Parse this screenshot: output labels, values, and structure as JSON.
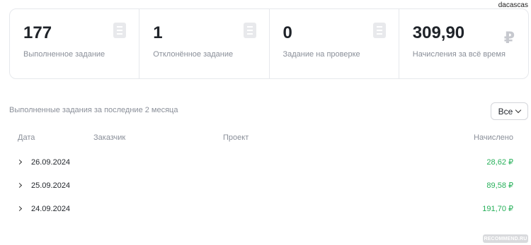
{
  "header": {
    "username": "dacascas"
  },
  "stats": [
    {
      "value": "177",
      "label": "Выполненное задание",
      "icon": "document-icon"
    },
    {
      "value": "1",
      "label": "Отклонённое задание",
      "icon": "document-icon"
    },
    {
      "value": "0",
      "label": "Задание на проверке",
      "icon": "document-icon"
    },
    {
      "value": "309,90",
      "label": "Начисления за всё время",
      "icon": "ruble-icon",
      "icon_glyph": "₽"
    }
  ],
  "history": {
    "title": "Выполненные задания за последние 2 месяца",
    "filter": {
      "selected": "Все"
    },
    "columns": {
      "date": "Дата",
      "client": "Заказчик",
      "project": "Проект",
      "amount": "Начислено"
    },
    "rows": [
      {
        "date": "26.09.2024",
        "client": "",
        "project": "",
        "amount": "28,62 ₽"
      },
      {
        "date": "25.09.2024",
        "client": "",
        "project": "",
        "amount": "89,58 ₽"
      },
      {
        "date": "24.09.2024",
        "client": "",
        "project": "",
        "amount": "191,70 ₽"
      }
    ]
  },
  "colors": {
    "accent_green": "#27b05a",
    "muted_text": "#8a8f99",
    "border": "#e6e8ec"
  },
  "watermark": "RECOMMEND.RU"
}
